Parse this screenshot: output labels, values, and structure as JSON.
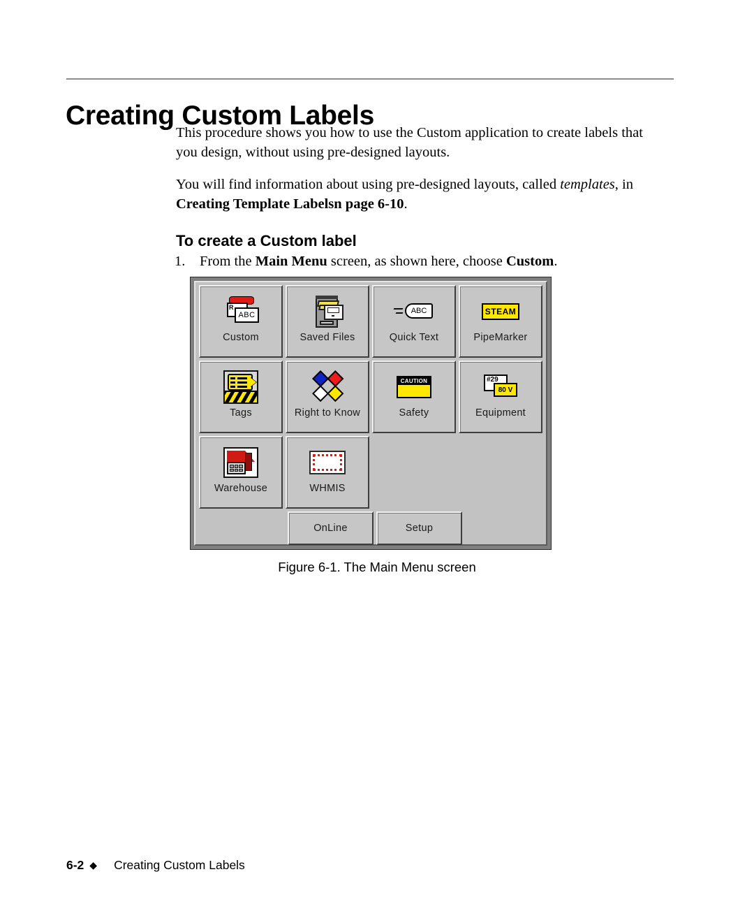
{
  "page_title": "Creating Custom Labels",
  "paragraphs": {
    "intro": "This procedure shows you how to use the Custom application to create labels that you design, without using pre-designed layouts.",
    "templates_lead": "You will find information about using pre-designed layouts, called ",
    "templates_italic": "templates",
    "templates_tail": ", in",
    "templates_bold": "Creating Template Labelsn page 6-10",
    "templates_period": "."
  },
  "section_heading": "To create a Custom label",
  "step": {
    "number": "1.",
    "pre": "From the ",
    "bold1": "Main Menu",
    "mid": " screen, as shown here, choose ",
    "bold2": "Custom",
    "post": "."
  },
  "screen": {
    "rows": [
      [
        {
          "label": "Custom",
          "icon": "custom-label-icon",
          "icon_text": {
            "r": "R",
            "abc": "ABC"
          }
        },
        {
          "label": "Saved Files",
          "icon": "file-cabinet-icon"
        },
        {
          "label": "Quick Text",
          "icon": "quick-text-icon",
          "icon_text": {
            "abc": "ABC"
          }
        },
        {
          "label": "PipeMarker",
          "icon": "pipe-marker-icon",
          "icon_text": {
            "plate": "STEAM"
          }
        }
      ],
      [
        {
          "label": "Tags",
          "icon": "hazard-tag-icon"
        },
        {
          "label": "Right to Know",
          "icon": "nfpa-diamond-icon"
        },
        {
          "label": "Safety",
          "icon": "caution-sign-icon",
          "icon_text": {
            "caption": "CAUTION"
          }
        },
        {
          "label": "Equipment",
          "icon": "equipment-label-icon",
          "icon_text": {
            "card1": "#29",
            "card2": "80 V"
          }
        }
      ],
      [
        {
          "label": "Warehouse",
          "icon": "warehouse-icon"
        },
        {
          "label": "WHMIS",
          "icon": "whmis-placard-icon"
        }
      ]
    ],
    "bottom_row": [
      {
        "label": "OnLine",
        "icon": "online-button"
      },
      {
        "label": "Setup",
        "icon": "setup-button"
      }
    ]
  },
  "figure_caption": "Figure 6-1. The Main Menu screen",
  "footer": {
    "page_number": "6-2",
    "diamond": "◆",
    "chapter": "Creating Custom Labels"
  },
  "colors": {
    "red": "#e01b14",
    "yellow": "#ffe800",
    "blue": "#1024c4",
    "panel_gray": "#c2c2c2",
    "button_gray": "#c6c6c6"
  }
}
